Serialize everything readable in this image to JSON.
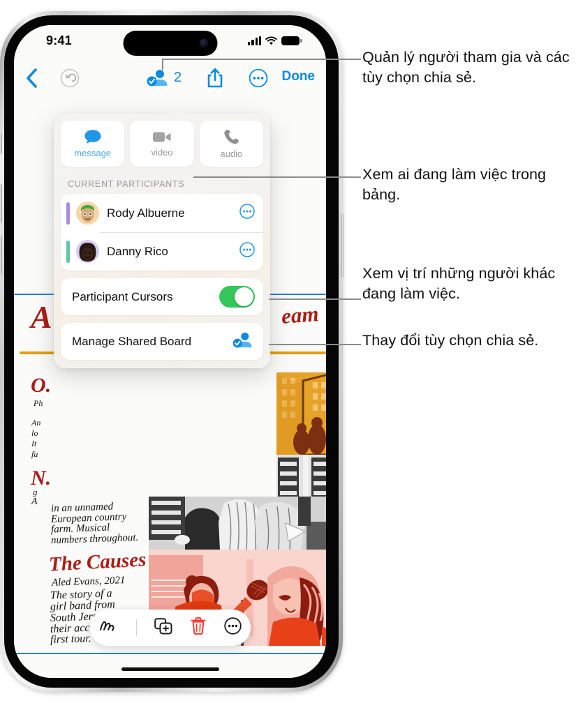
{
  "status_bar": {
    "time": "9:41",
    "cellular_icon": "signal-bars-icon",
    "wifi_icon": "wifi-icon",
    "battery_icon": "battery-icon"
  },
  "nav_bar": {
    "back_icon": "chevron-left-icon",
    "undo_icon": "undo-icon",
    "participants_icon": "participants-badge-icon",
    "participants_count": "2",
    "share_icon": "share-icon",
    "more_icon": "ellipsis-circle-icon",
    "done_label": "Done"
  },
  "popover": {
    "modes": [
      {
        "label": "message",
        "icon": "message-bubble-icon",
        "active": true
      },
      {
        "label": "video",
        "icon": "video-camera-icon",
        "active": false
      },
      {
        "label": "audio",
        "icon": "phone-handset-icon",
        "active": false
      }
    ],
    "section_header": "CURRENT PARTICIPANTS",
    "participants": [
      {
        "name": "Rody Albuerne",
        "bar_color": "#a98ce0",
        "avatar_bg": "#f7d7a8",
        "more_icon": "ellipsis-circle-icon"
      },
      {
        "name": "Danny Rico",
        "bar_color": "#5fc6a6",
        "avatar_bg": "#d9ccf3",
        "more_icon": "ellipsis-circle-icon"
      }
    ],
    "cursors_toggle": {
      "label": "Participant Cursors",
      "state": "on",
      "on_color": "#34c759"
    },
    "manage": {
      "label": "Manage Shared Board",
      "icon": "participants-badge-icon"
    }
  },
  "board": {
    "handwriting": [
      {
        "text": "A",
        "style": "red-heading"
      },
      {
        "text": "eam",
        "style": "red-script"
      },
      {
        "text": "O.",
        "style": "red-heading"
      },
      {
        "text": "N.",
        "style": "red-heading"
      },
      {
        "text": "in an unnamed",
        "style": "black-script"
      },
      {
        "text": "European country",
        "style": "black-script"
      },
      {
        "text": "farm. Musical",
        "style": "black-script"
      },
      {
        "text": "numbers throughout.",
        "style": "black-script"
      },
      {
        "text": "The Causes",
        "style": "red-script-large"
      },
      {
        "text": "Aled Evans, 2021",
        "style": "black-script"
      },
      {
        "text": "The story of a",
        "style": "black-script"
      },
      {
        "text": "girl band from",
        "style": "black-script"
      },
      {
        "text": "South Jersey and",
        "style": "black-script"
      },
      {
        "text": "their accidental",
        "style": "black-script"
      },
      {
        "text": "first tour.",
        "style": "black-script"
      }
    ]
  },
  "toolbar": {
    "items": [
      {
        "icon": "scribble-pen-icon",
        "name": "draw-tool"
      },
      {
        "icon": "add-card-icon",
        "name": "insert-tool"
      },
      {
        "icon": "trash-icon",
        "name": "delete-tool"
      },
      {
        "icon": "ellipsis-circle-icon",
        "name": "more-tool"
      }
    ]
  },
  "callouts": [
    {
      "id": "callout-manage-participants",
      "text": "Quản lý người tham gia và các tùy chọn chia sẻ."
    },
    {
      "id": "callout-see-who",
      "text": "Xem ai đang làm việc trong bảng."
    },
    {
      "id": "callout-see-where",
      "text": "Xem vị trí những người khác đang làm việc."
    },
    {
      "id": "callout-change-sharing",
      "text": "Thay đổi tùy chọn chia sẻ."
    }
  ],
  "colors": {
    "accent_blue": "#0b8ae0",
    "toggle_green": "#34c759",
    "trash_red": "#ff3b30",
    "leader_line": "#8a8a8a",
    "handwriting_red": "#ab1d17",
    "rule_blue": "#2f7ddb",
    "rule_orange": "#e89c10"
  }
}
